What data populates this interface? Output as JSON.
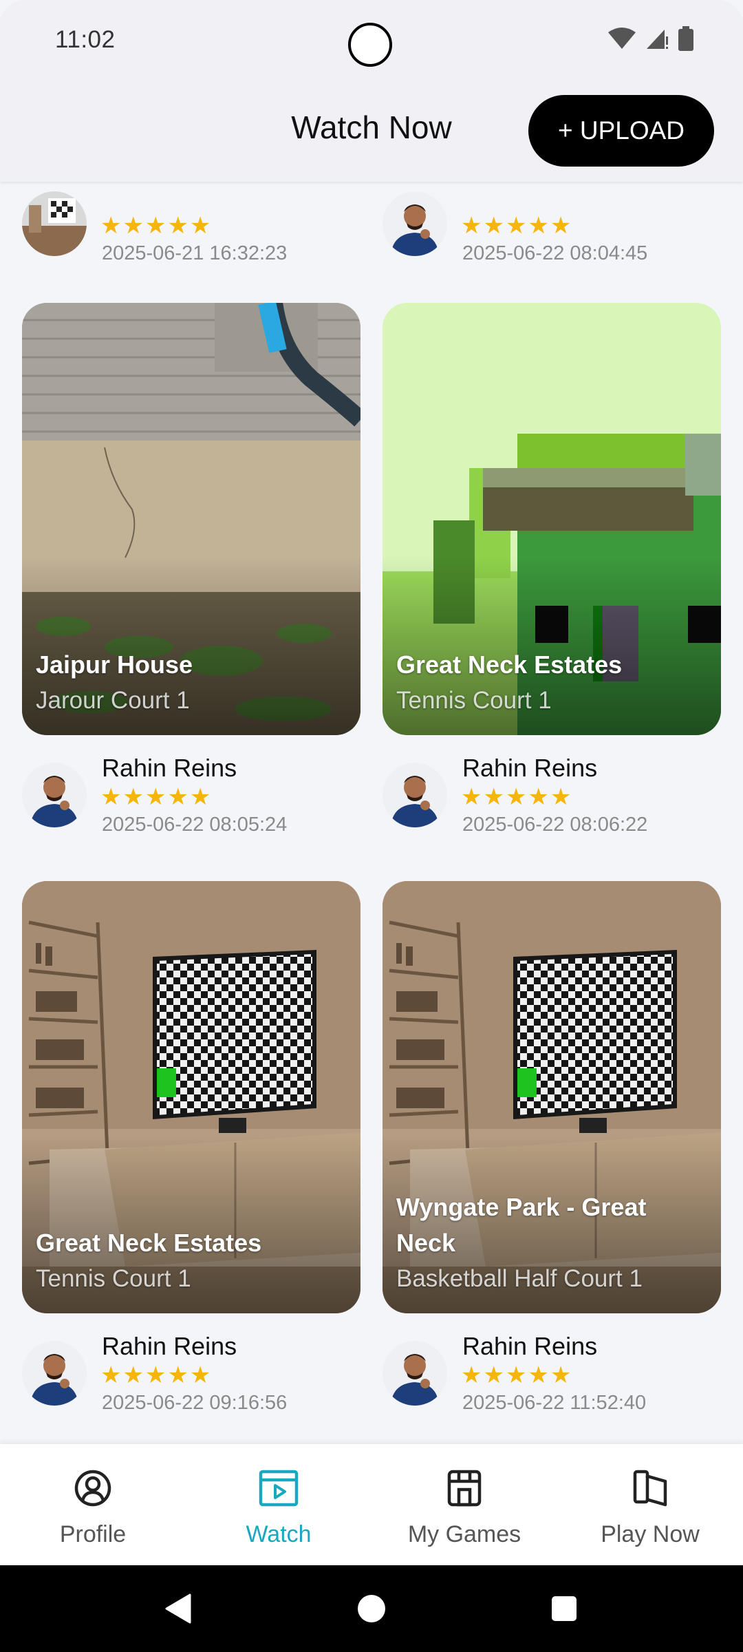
{
  "status_bar": {
    "time": "11:02"
  },
  "header": {
    "title": "Watch Now",
    "upload_label": "+ UPLOAD"
  },
  "feed": {
    "partial": [
      {
        "rating": "★★★★★",
        "timestamp": "2025-06-21 16:32:23"
      },
      {
        "rating": "★★★★★",
        "timestamp": "2025-06-22 08:04:45"
      }
    ],
    "cards": [
      {
        "venue": "Jaipur House",
        "court": "Jarour Court 1",
        "user": "Rahin Reins",
        "rating": "★★★★★",
        "timestamp": "2025-06-22 08:05:24"
      },
      {
        "venue": "Great Neck Estates",
        "court": "Tennis Court 1",
        "user": "Rahin Reins",
        "rating": "★★★★★",
        "timestamp": "2025-06-22 08:06:22"
      },
      {
        "venue": "Great Neck Estates",
        "court": "Tennis Court 1",
        "user": "Rahin Reins",
        "rating": "★★★★★",
        "timestamp": "2025-06-22 09:16:56"
      },
      {
        "venue": "Wyngate Park - Great Neck",
        "court": "Basketball Half Court 1",
        "user": "Rahin Reins",
        "rating": "★★★★★",
        "timestamp": "2025-06-22 11:52:40"
      }
    ]
  },
  "bottom_nav": {
    "items": [
      {
        "label": "Profile",
        "icon": "profile-icon"
      },
      {
        "label": "Watch",
        "icon": "watch-icon"
      },
      {
        "label": "My Games",
        "icon": "games-icon"
      },
      {
        "label": "Play Now",
        "icon": "play-now-icon"
      }
    ],
    "active": "Watch"
  },
  "colors": {
    "accent": "#18a9bf",
    "star": "#f5b50a",
    "header_bg": "#f0f0f5",
    "upload_bg": "#000000"
  }
}
